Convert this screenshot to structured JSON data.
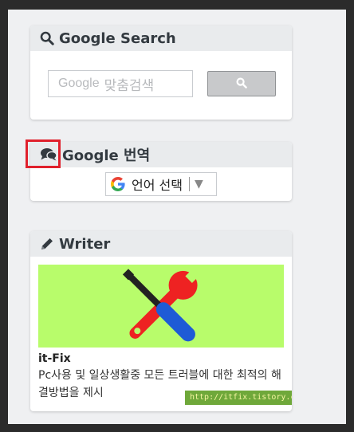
{
  "search_widget": {
    "title": "Google Search",
    "icon": "search-icon",
    "input_logo": "Google",
    "input_placeholder": "맞춤검색",
    "button_icon": "search-icon"
  },
  "translate_widget": {
    "title": "Google 번역",
    "icon": "comments-icon",
    "select_label": "언어 선택",
    "select_arrow": "▼"
  },
  "writer_widget": {
    "title": "Writer",
    "icon": "pencil-icon",
    "name": "it-Fix",
    "description": "Pc사용 및 일상생활중 모든 트러블에 대한 최적의 해결방법을 제시",
    "url": "http://itfix.tistory.com"
  },
  "colors": {
    "highlight_box": "#e0202c",
    "image_bg": "#b8fc6b",
    "header_bg": "#e9ebed"
  }
}
